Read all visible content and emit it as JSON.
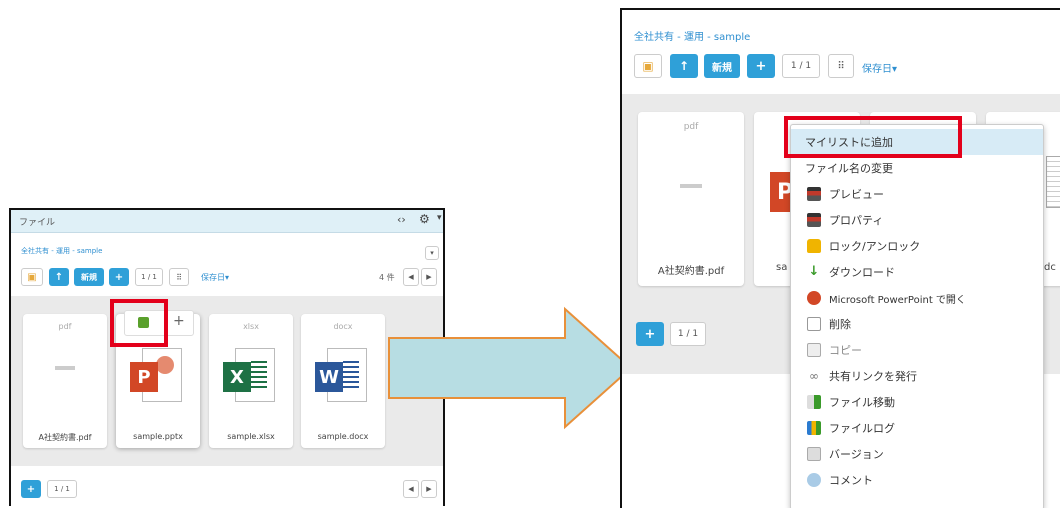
{
  "left_panel": {
    "header_title": "ファイル",
    "header_code_icon": "code-icon",
    "header_gear_icon": "gear-icon",
    "breadcrumb": "全社共有 - 運用 - sample",
    "toolbar": {
      "new_label": "新規",
      "plus_label": "+",
      "page": "1 / 1",
      "sort_label": "保存日▾",
      "count": "4 件"
    },
    "files": [
      {
        "ext": "pdf",
        "name": "A社契約書.pdf",
        "icon": "pdf-thumbnail"
      },
      {
        "ext": "",
        "name": "sample.pptx",
        "icon": "powerpoint-icon",
        "letter": "P"
      },
      {
        "ext": "xlsx",
        "name": "sample.xlsx",
        "icon": "excel-icon",
        "letter": "X"
      },
      {
        "ext": "docx",
        "name": "sample.docx",
        "icon": "word-icon",
        "letter": "W"
      }
    ],
    "hover_add_label": "+",
    "footer_page": "1 / 1"
  },
  "right_panel": {
    "breadcrumb": "全社共有 - 運用 - sample",
    "toolbar": {
      "new_label": "新規",
      "plus_label": "+",
      "page": "1 / 1",
      "sort_label": "保存日▾"
    },
    "cards": [
      {
        "ext": "pdf",
        "name": "A社契約書.pdf"
      },
      {
        "ext": "",
        "name": "sa"
      },
      {
        "ext": "",
        "name": ""
      },
      {
        "ext": "",
        "name": "dc"
      }
    ],
    "footer_page": "1 / 1",
    "context_menu": [
      {
        "label": "マイリストに追加",
        "icon": "none"
      },
      {
        "label": "ファイル名の変更",
        "icon": "none"
      },
      {
        "label": "プレビュー",
        "icon": "preview-icon"
      },
      {
        "label": "プロパティ",
        "icon": "property-icon"
      },
      {
        "label": "ロック/アンロック",
        "icon": "lock-icon"
      },
      {
        "label": "ダウンロード",
        "icon": "download-icon"
      },
      {
        "label": "Microsoft PowerPoint で開く",
        "icon": "powerpoint-icon"
      },
      {
        "label": "削除",
        "icon": "delete-icon"
      },
      {
        "label": "コピー",
        "icon": "copy-icon"
      },
      {
        "label": "共有リンクを発行",
        "icon": "link-icon"
      },
      {
        "label": "ファイル移動",
        "icon": "move-icon"
      },
      {
        "label": "ファイルログ",
        "icon": "log-icon"
      },
      {
        "label": "バージョン",
        "icon": "version-icon"
      },
      {
        "label": "コメント",
        "icon": "comment-icon"
      }
    ]
  },
  "colors": {
    "accent_blue": "#2fa0d8",
    "highlight_red": "#e3001b",
    "arrow_fill": "#b7dde3",
    "arrow_stroke": "#e8903a",
    "powerpoint": "#d24726",
    "excel": "#1e7145",
    "word": "#2b579a"
  }
}
